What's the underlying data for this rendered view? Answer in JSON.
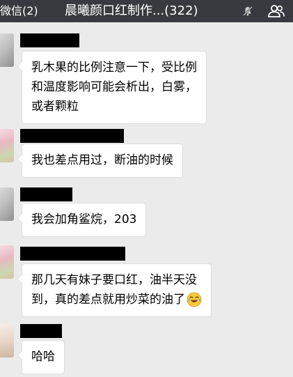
{
  "header": {
    "back_label": "微信(2)",
    "title": "晨曦颜口红制作...(322)",
    "icons": [
      "mute-icon",
      "group-members-icon"
    ]
  },
  "messages": [
    {
      "lines": [
        "乳木果的比例注意一下，受比例",
        "和温度影响可能会析出，白雾，",
        "或者颗粒"
      ]
    },
    {
      "lines": [
        "我也差点用过，断油的时候"
      ]
    },
    {
      "lines": [
        "我会加角鲨烷，203"
      ]
    },
    {
      "lines": [
        "那几天有妹子要口红，油半天没",
        "到，真的差点就用炒菜的油了"
      ],
      "emoji": "laughing-crying-emoji"
    },
    {
      "lines": [
        "哈哈"
      ]
    }
  ]
}
